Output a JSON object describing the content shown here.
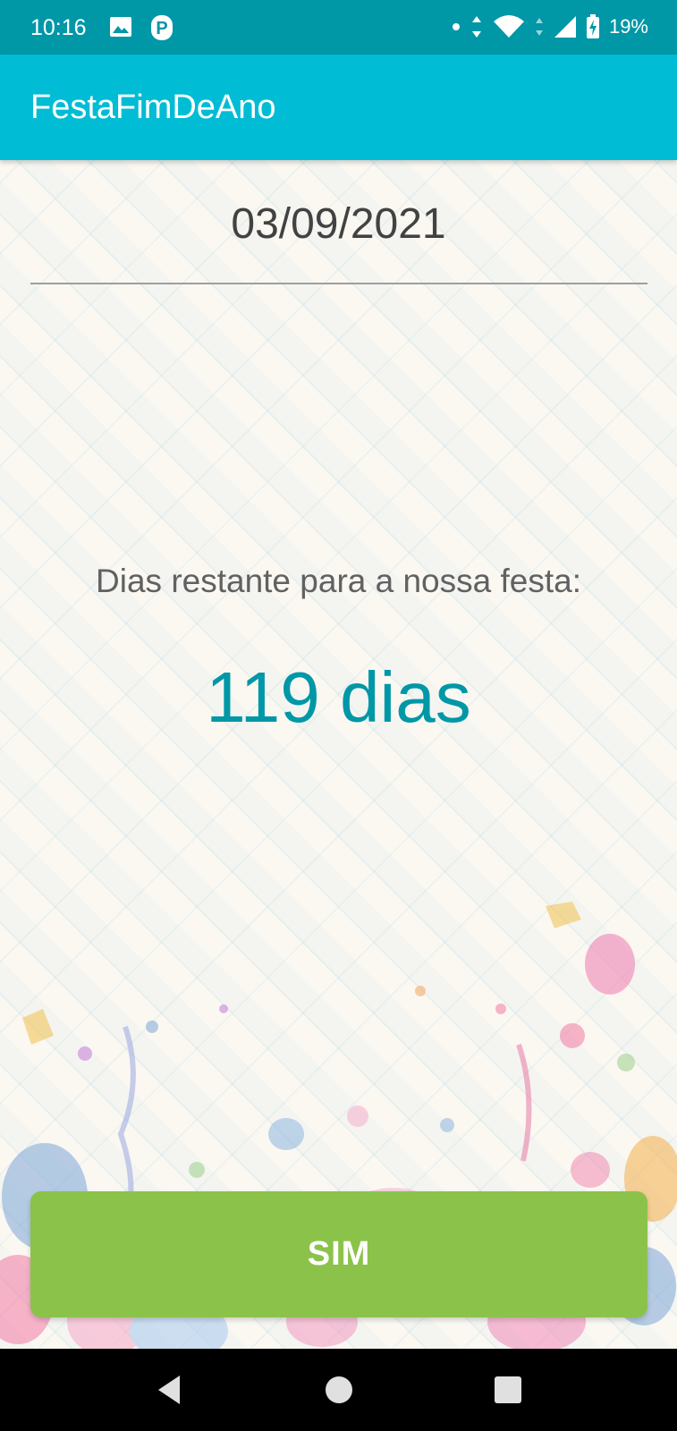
{
  "status_bar": {
    "time": "10:16",
    "battery": "19%",
    "icons": [
      "image-icon",
      "parking-icon",
      "dot-icon",
      "data-arrows-icon",
      "wifi-icon",
      "signal-icon",
      "battery-charging-icon"
    ]
  },
  "app_bar": {
    "title": "FestaFimDeAno"
  },
  "main": {
    "date": "03/09/2021",
    "countdown_label": "Dias restante para a nossa festa:",
    "countdown_value": "119 dias",
    "button_label": "SIM"
  },
  "nav_bar": {
    "icons": [
      "back-icon",
      "home-icon",
      "recents-icon"
    ]
  },
  "colors": {
    "status_bar": "#0097a7",
    "app_bar": "#00bcd4",
    "accent_text": "#0097a7",
    "button": "#8bc34a",
    "background": "#fbf8f2"
  }
}
